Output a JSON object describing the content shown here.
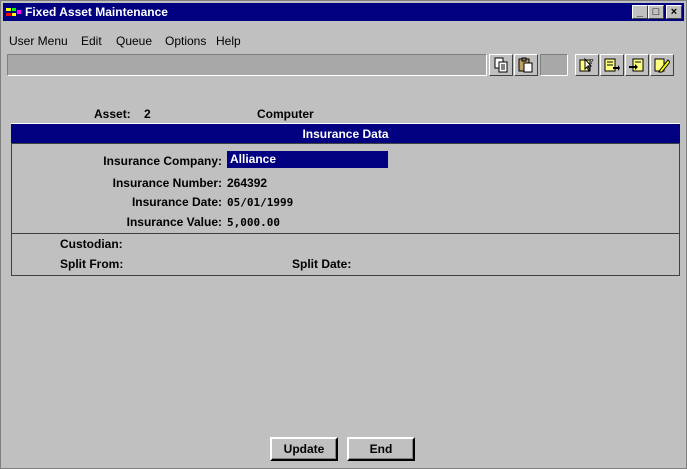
{
  "window": {
    "title": "Fixed Asset Maintenance",
    "controls": {
      "minimize": "_",
      "maximize": "□",
      "close": "×"
    }
  },
  "menu": {
    "items": [
      {
        "label": "User Menu"
      },
      {
        "label": "Edit"
      },
      {
        "label": "Queue"
      },
      {
        "label": "Options"
      },
      {
        "label": "Help"
      }
    ]
  },
  "toolbar": {
    "icons": [
      "copy-icon",
      "paste-icon",
      "help-pointer-icon",
      "export-icon",
      "import-icon",
      "edit-pencil-icon"
    ]
  },
  "asset": {
    "label": "Asset:",
    "number": "2",
    "description": "Computer"
  },
  "section": {
    "title": "Insurance Data"
  },
  "fields": {
    "company_label": "Insurance Company:",
    "company_value": "Alliance",
    "number_label": "Insurance Number:",
    "number_value": "264392",
    "date_label": "Insurance Date:",
    "date_value": "05/01/1999",
    "value_label": "Insurance Value:",
    "value_value": "5,000.00"
  },
  "extra": {
    "custodian_label": "Custodian:",
    "split_from_label": "Split From:",
    "split_date_label": "Split Date:"
  },
  "buttons": {
    "update": "Update",
    "end": "End"
  },
  "colors": {
    "titlebar": "#000080",
    "section": "#000080",
    "face": "#c0c0c0"
  }
}
